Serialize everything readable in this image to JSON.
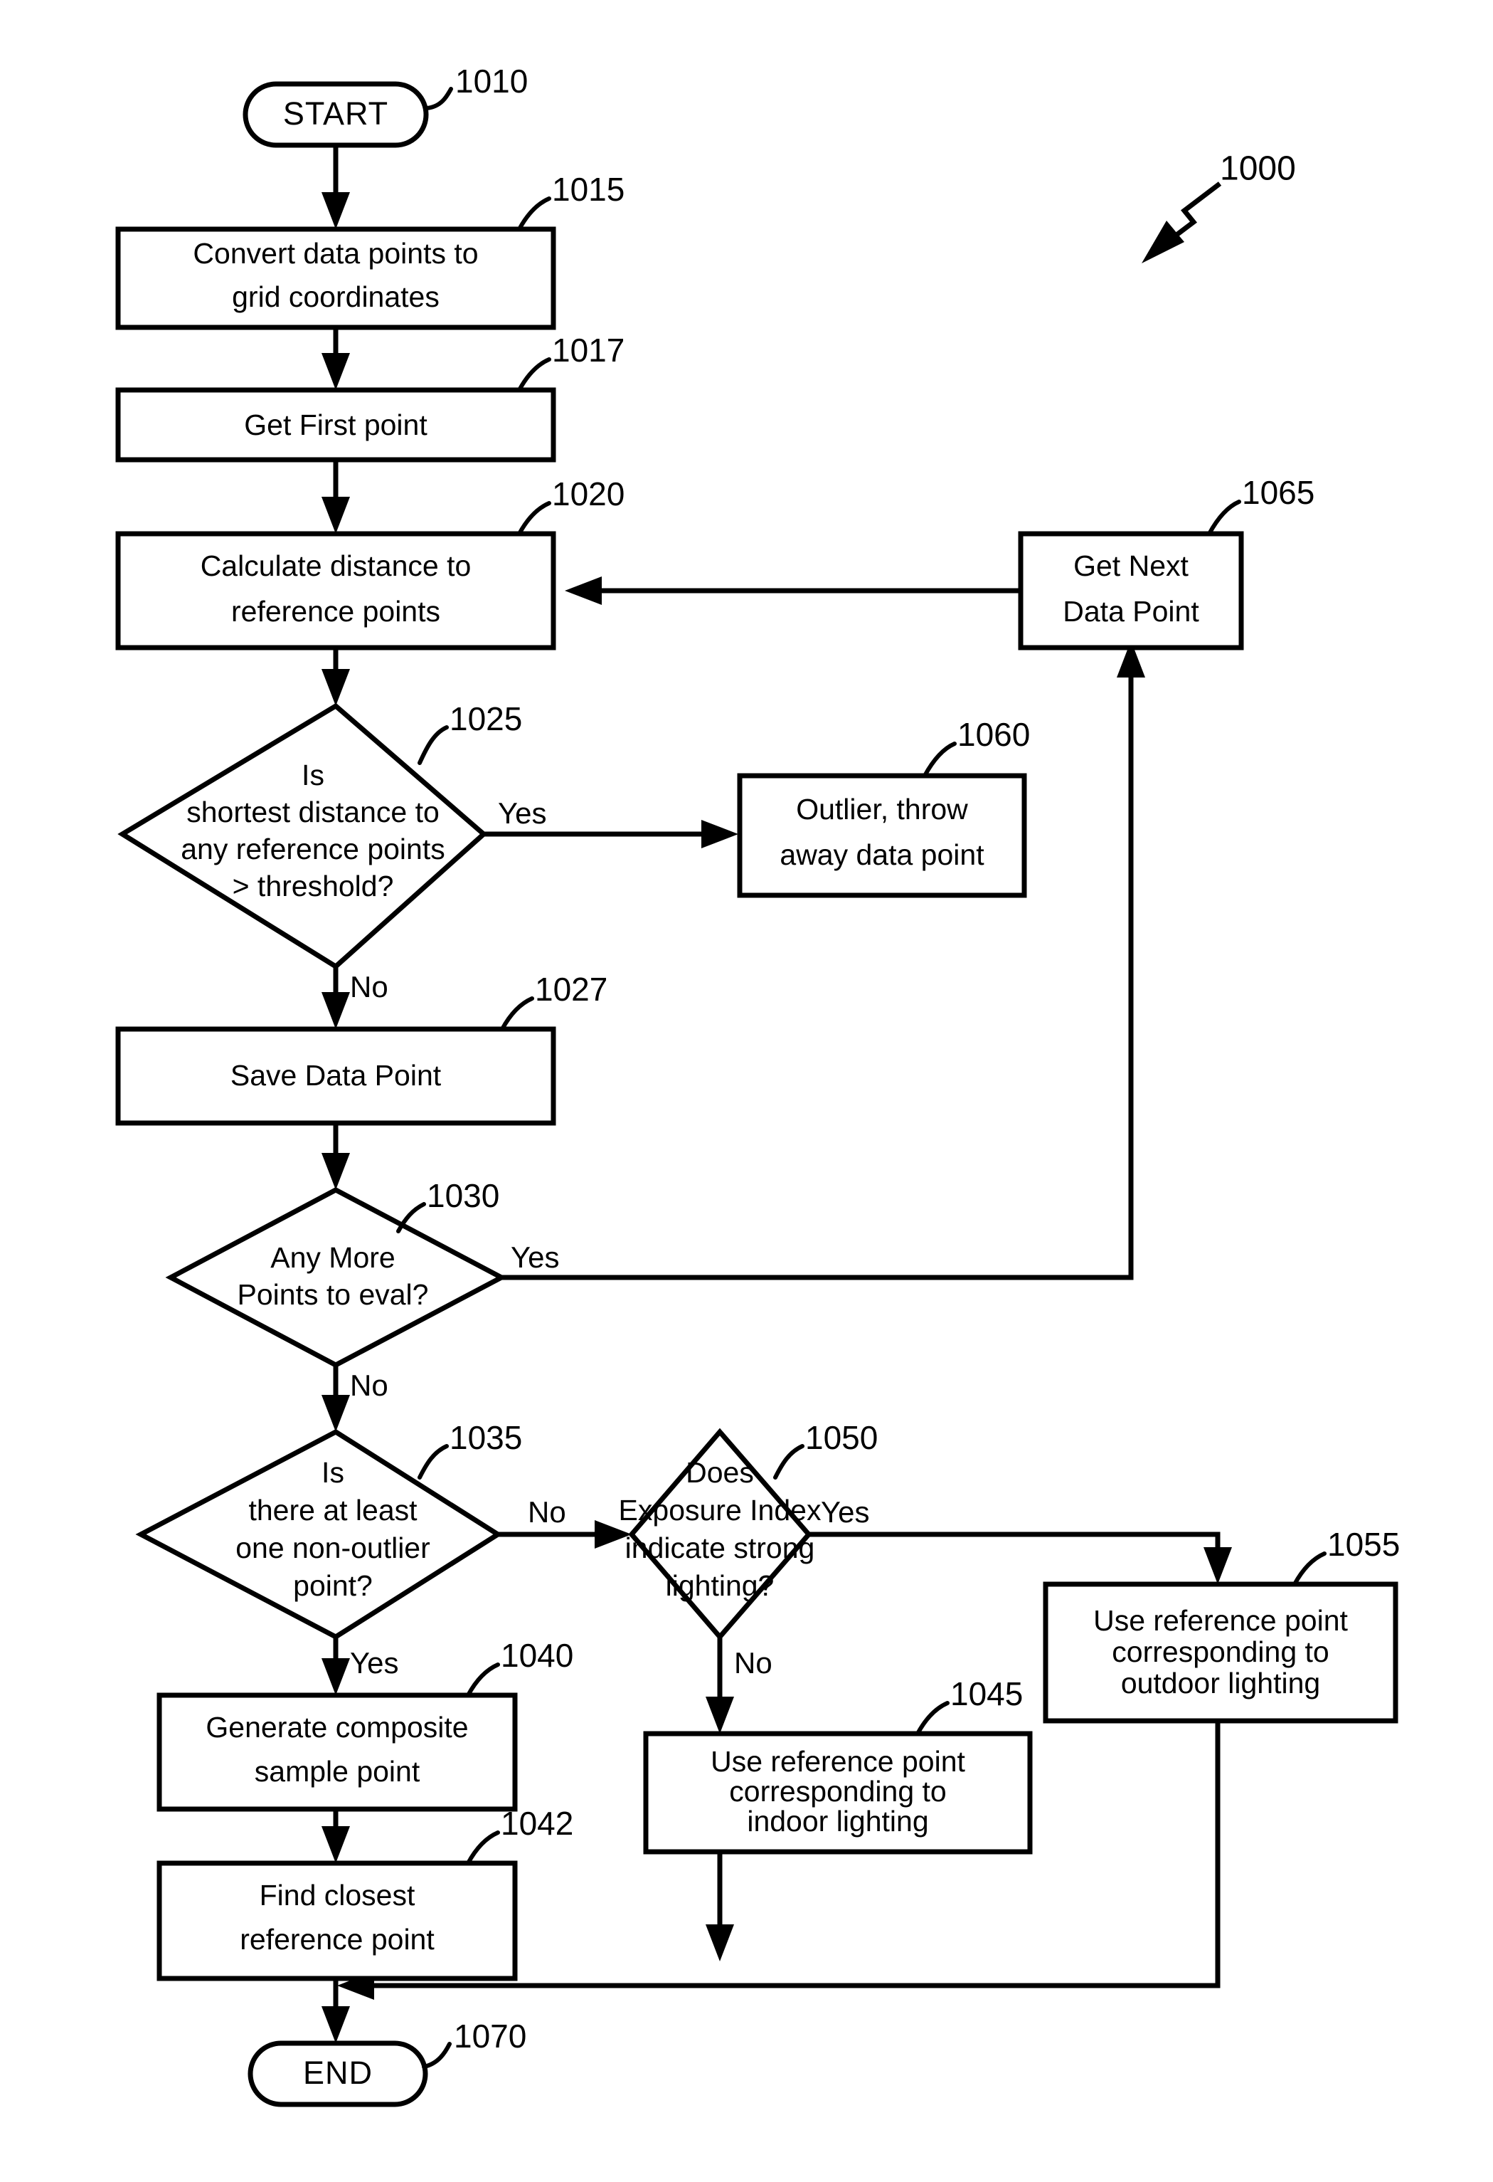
{
  "figure": {
    "number": "1000",
    "pointer_icon": "lightning-pointer-arrow"
  },
  "nodes": {
    "start": {
      "label": "START",
      "ref": "1010",
      "shape": "terminator"
    },
    "convert": {
      "line1": "Convert data points to",
      "line2": "grid coordinates",
      "ref": "1015",
      "shape": "process"
    },
    "get_first": {
      "line1": "Get First point",
      "ref": "1017",
      "shape": "process"
    },
    "calc_distance": {
      "line1": "Calculate distance to",
      "line2": "reference points",
      "ref": "1020",
      "shape": "process"
    },
    "shortest_distance": {
      "line1": "Is",
      "line2": "shortest distance to",
      "line3": "any reference points",
      "line4": "> threshold?",
      "ref": "1025",
      "shape": "decision"
    },
    "save_point": {
      "line1": "Save Data Point",
      "ref": "1027",
      "shape": "process"
    },
    "any_more": {
      "line1": "Any More",
      "line2": "Points to eval?",
      "ref": "1030",
      "shape": "decision"
    },
    "non_outlier": {
      "line1": "Is",
      "line2": "there at least",
      "line3": "one non-outlier",
      "line4": "point?",
      "ref": "1035",
      "shape": "decision"
    },
    "composite": {
      "line1": "Generate composite",
      "line2": "sample point",
      "ref": "1040",
      "shape": "process"
    },
    "find_closest": {
      "line1": "Find closest",
      "line2": "reference point",
      "ref": "1042",
      "shape": "process"
    },
    "indoor": {
      "line1": "Use reference point",
      "line2": "corresponding to",
      "line3": "indoor lighting",
      "ref": "1045",
      "shape": "process"
    },
    "exposure": {
      "line1": "Does",
      "line2": "Exposure Index",
      "line3": "indicate strong",
      "line4": "lighting?",
      "ref": "1050",
      "shape": "decision"
    },
    "outdoor": {
      "line1": "Use reference point",
      "line2": "corresponding to",
      "line3": "outdoor lighting",
      "ref": "1055",
      "shape": "process"
    },
    "outlier": {
      "line1": "Outlier, throw",
      "line2": "away data point",
      "ref": "1060",
      "shape": "process"
    },
    "get_next": {
      "line1": "Get Next",
      "line2": "Data Point",
      "ref": "1065",
      "shape": "process"
    },
    "end": {
      "label": "END",
      "ref": "1070",
      "shape": "terminator"
    }
  },
  "edge_labels": {
    "shortest_yes": "Yes",
    "shortest_no": "No",
    "any_more_yes": "Yes",
    "any_more_no": "No",
    "non_outlier_no": "No",
    "non_outlier_yes": "Yes",
    "exposure_yes": "Yes",
    "exposure_no": "No"
  },
  "colors": {
    "stroke": "#000000",
    "fill": "#ffffff",
    "text": "#000000"
  }
}
